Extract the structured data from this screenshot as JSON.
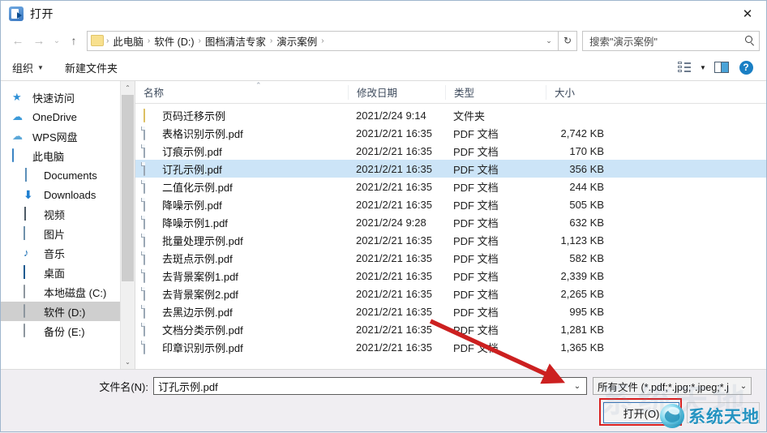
{
  "window": {
    "title": "打开",
    "icon": "open-file-icon",
    "close_label": "✕"
  },
  "nav": {
    "back_icon": "←",
    "forward_icon": "→",
    "recent_icon": "⌄",
    "up_icon": "↑",
    "breadcrumbs": [
      "此电脑",
      "软件 (D:)",
      "图档清洁专家",
      "演示案例"
    ],
    "separator": "›",
    "dropdown_icon": "⌄",
    "refresh_icon": "↻"
  },
  "search": {
    "placeholder": "搜索\"演示案例\"",
    "icon": "search-icon"
  },
  "command_bar": {
    "organize_label": "组织",
    "organize_caret": "▼",
    "new_folder_label": "新建文件夹",
    "view_caret": "▼",
    "help_label": "?"
  },
  "sidebar": {
    "items": [
      {
        "label": "快速访问",
        "icon": "star-icon",
        "indent": false,
        "selected": false
      },
      {
        "label": "OneDrive",
        "icon": "cloud-icon",
        "indent": false,
        "selected": false
      },
      {
        "label": "WPS网盘",
        "icon": "cloud-icon",
        "indent": false,
        "selected": false
      },
      {
        "label": "此电脑",
        "icon": "this-pc-icon",
        "indent": false,
        "selected": false
      },
      {
        "label": "Documents",
        "icon": "documents-icon",
        "indent": true,
        "selected": false
      },
      {
        "label": "Downloads",
        "icon": "downloads-icon",
        "indent": true,
        "selected": false
      },
      {
        "label": "视频",
        "icon": "videos-icon",
        "indent": true,
        "selected": false
      },
      {
        "label": "图片",
        "icon": "pictures-icon",
        "indent": true,
        "selected": false
      },
      {
        "label": "音乐",
        "icon": "music-icon",
        "indent": true,
        "selected": false
      },
      {
        "label": "桌面",
        "icon": "desktop-icon",
        "indent": true,
        "selected": false
      },
      {
        "label": "本地磁盘 (C:)",
        "icon": "drive-icon",
        "indent": true,
        "selected": false
      },
      {
        "label": "软件 (D:)",
        "icon": "drive-icon",
        "indent": true,
        "selected": true
      },
      {
        "label": "备份 (E:)",
        "icon": "drive-icon",
        "indent": true,
        "selected": false
      }
    ],
    "scroll_up_icon": "⌃",
    "scroll_down_icon": "⌄"
  },
  "filelist": {
    "columns": [
      "名称",
      "修改日期",
      "类型",
      "大小"
    ],
    "sort_indicator": "⌃",
    "rows": [
      {
        "name": "页码迁移示例",
        "date": "2021/2/24 9:14",
        "type": "文件夹",
        "size": "",
        "kind": "folder",
        "selected": false
      },
      {
        "name": "表格识别示例.pdf",
        "date": "2021/2/21 16:35",
        "type": "PDF 文档",
        "size": "2,742 KB",
        "kind": "pdf",
        "selected": false
      },
      {
        "name": "订痕示例.pdf",
        "date": "2021/2/21 16:35",
        "type": "PDF 文档",
        "size": "170 KB",
        "kind": "pdf",
        "selected": false
      },
      {
        "name": "订孔示例.pdf",
        "date": "2021/2/21 16:35",
        "type": "PDF 文档",
        "size": "356 KB",
        "kind": "pdf",
        "selected": true
      },
      {
        "name": "二值化示例.pdf",
        "date": "2021/2/21 16:35",
        "type": "PDF 文档",
        "size": "244 KB",
        "kind": "pdf",
        "selected": false
      },
      {
        "name": "降噪示例.pdf",
        "date": "2021/2/21 16:35",
        "type": "PDF 文档",
        "size": "505 KB",
        "kind": "pdf",
        "selected": false
      },
      {
        "name": "降噪示例1.pdf",
        "date": "2021/2/24 9:28",
        "type": "PDF 文档",
        "size": "632 KB",
        "kind": "pdf",
        "selected": false
      },
      {
        "name": "批量处理示例.pdf",
        "date": "2021/2/21 16:35",
        "type": "PDF 文档",
        "size": "1,123 KB",
        "kind": "pdf",
        "selected": false
      },
      {
        "name": "去斑点示例.pdf",
        "date": "2021/2/21 16:35",
        "type": "PDF 文档",
        "size": "582 KB",
        "kind": "pdf",
        "selected": false
      },
      {
        "name": "去背景案例1.pdf",
        "date": "2021/2/21 16:35",
        "type": "PDF 文档",
        "size": "2,339 KB",
        "kind": "pdf",
        "selected": false
      },
      {
        "name": "去背景案例2.pdf",
        "date": "2021/2/21 16:35",
        "type": "PDF 文档",
        "size": "2,265 KB",
        "kind": "pdf",
        "selected": false
      },
      {
        "name": "去黑边示例.pdf",
        "date": "2021/2/21 16:35",
        "type": "PDF 文档",
        "size": "995 KB",
        "kind": "pdf",
        "selected": false
      },
      {
        "name": "文档分类示例.pdf",
        "date": "2021/2/21 16:35",
        "type": "PDF 文档",
        "size": "1,281 KB",
        "kind": "pdf",
        "selected": false
      },
      {
        "name": "印章识别示例.pdf",
        "date": "2021/2/21 16:35",
        "type": "PDF 文档",
        "size": "1,365 KB",
        "kind": "pdf",
        "selected": false
      }
    ]
  },
  "footer": {
    "filename_label": "文件名(N):",
    "filename_value": "订孔示例.pdf",
    "filename_caret": "⌄",
    "filter_value": "所有文件 (*.pdf;*.jpg;*.jpeg;*.j",
    "filter_caret": "⌄",
    "open_label": "打开(O)",
    "cancel_label": ""
  },
  "annotations": {
    "arrow_color": "#cc2020",
    "highlight_color": "#d81f1f"
  },
  "watermark": {
    "text": "系统天地",
    "ghost_text": "系统天地",
    "logo": "globe-logo"
  }
}
